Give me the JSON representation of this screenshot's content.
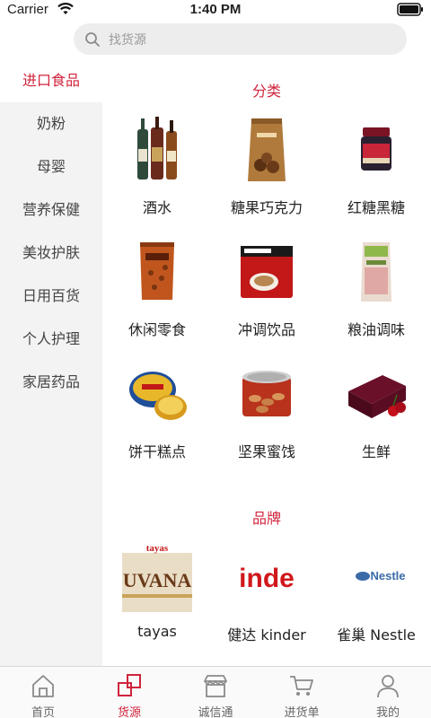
{
  "status_bar": {
    "carrier": "Carrier",
    "time": "1:40 PM"
  },
  "search": {
    "placeholder": "找货源"
  },
  "sidebar": {
    "items": [
      {
        "label": "进口食品",
        "active": true
      },
      {
        "label": "奶粉"
      },
      {
        "label": "母婴"
      },
      {
        "label": "营养保健"
      },
      {
        "label": "美妆护肤"
      },
      {
        "label": "日用百货"
      },
      {
        "label": "个人护理"
      },
      {
        "label": "家居药品"
      }
    ]
  },
  "categories": {
    "title": "分类",
    "items": [
      {
        "label": "酒水",
        "icon": "liquor-bottles"
      },
      {
        "label": "糖果巧克力",
        "icon": "chocolate-bag"
      },
      {
        "label": "红糖黑糖",
        "icon": "sugar-jar"
      },
      {
        "label": "休闲零食",
        "icon": "snack-bag"
      },
      {
        "label": "冲调饮品",
        "icon": "coffee-pack"
      },
      {
        "label": "粮油调味",
        "icon": "salt-bag"
      },
      {
        "label": "饼干糕点",
        "icon": "cookie-tin"
      },
      {
        "label": "坚果蜜饯",
        "icon": "nut-can"
      },
      {
        "label": "生鲜",
        "icon": "cherry-box"
      }
    ]
  },
  "brands": {
    "title": "品牌",
    "items": [
      {
        "label": "tayas",
        "logo_text": "tayas",
        "logo_sub": "UVANA"
      },
      {
        "label": "健达 kinder",
        "logo_text": "inde"
      },
      {
        "label": "雀巢 Nestle",
        "logo_text": "Nestle"
      }
    ]
  },
  "tabbar": {
    "items": [
      {
        "label": "首页",
        "icon": "home-icon"
      },
      {
        "label": "货源",
        "icon": "source-icon",
        "active": true
      },
      {
        "label": "诚信通",
        "icon": "store-icon"
      },
      {
        "label": "进货单",
        "icon": "cart-icon"
      },
      {
        "label": "我的",
        "icon": "user-icon"
      }
    ]
  },
  "colors": {
    "accent": "#d0243c",
    "sidebar_bg": "#f3f3f3",
    "search_bg": "#ededed"
  }
}
